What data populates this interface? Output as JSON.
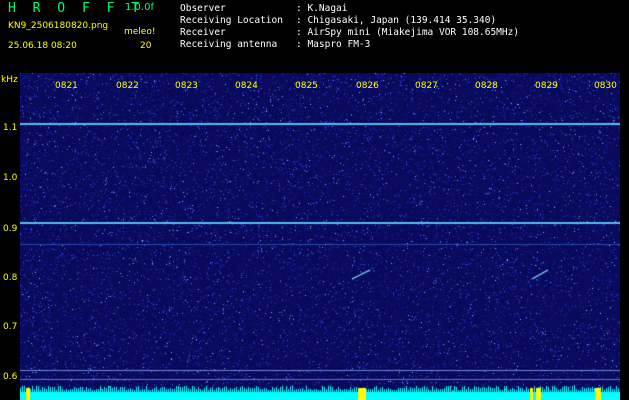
{
  "header": {
    "app_title": "H R O F F T",
    "app_version": "1.0.0f",
    "file_name": "KN9_2506180820.png",
    "timestamp": "25.06.18 08:20",
    "meleo_label": "meleo!",
    "meleo_value": "20"
  },
  "info": [
    {
      "label": "Observer",
      "value": ": K.Nagai"
    },
    {
      "label": "Receiving Location",
      "value": ": Chigasaki, Japan (139.414 35.340)"
    },
    {
      "label": "Receiver",
      "value": ": AirSpy mini (Miakejima VOR 108.65MHz)"
    },
    {
      "label": "Receiving antenna",
      "value": ": Maspro FM-3"
    }
  ],
  "axis": {
    "unit_label": "kHz",
    "y_ticks": [
      "1.1",
      "1.0",
      "0.9",
      "0.8",
      "0.7",
      "0.6"
    ],
    "x_ticks": [
      "0821",
      "0822",
      "0823",
      "0824",
      "0825",
      "0826",
      "0827",
      "0828",
      "0829",
      "0830"
    ]
  },
  "colors": {
    "background": "#000000",
    "spectrum_bg": "#0a0a5c",
    "title_green": "#00ff66",
    "label_yellow": "#ffff00",
    "text_white": "#ffffff",
    "signal_cyan": "#00ffff"
  }
}
